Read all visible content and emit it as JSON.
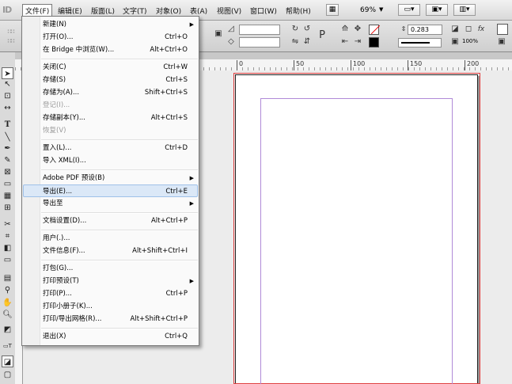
{
  "app": {
    "logo": "ID"
  },
  "menubar": {
    "items": [
      {
        "label": "文件(F)",
        "active": true
      },
      {
        "label": "编辑(E)"
      },
      {
        "label": "版面(L)"
      },
      {
        "label": "文字(T)"
      },
      {
        "label": "对象(O)"
      },
      {
        "label": "表(A)"
      },
      {
        "label": "视图(V)"
      },
      {
        "label": "窗口(W)"
      },
      {
        "label": "帮助(H)"
      }
    ],
    "zoom": "69%"
  },
  "controlbar": {
    "stroke_weight": "0.283",
    "opacity": "100%"
  },
  "ruler": {
    "labels": [
      "0",
      "50",
      "100",
      "150",
      "200"
    ]
  },
  "file_menu": {
    "items": [
      {
        "label": "新建(N)",
        "shortcut": "",
        "submenu": true
      },
      {
        "label": "打开(O)...",
        "shortcut": "Ctrl+O"
      },
      {
        "label": "在 Bridge 中浏览(W)...",
        "shortcut": "Alt+Ctrl+O"
      },
      {
        "separator": true
      },
      {
        "label": "关闭(C)",
        "shortcut": "Ctrl+W"
      },
      {
        "label": "存储(S)",
        "shortcut": "Ctrl+S"
      },
      {
        "label": "存储为(A)...",
        "shortcut": "Shift+Ctrl+S"
      },
      {
        "label": "登记(I)...",
        "shortcut": "",
        "disabled": true
      },
      {
        "label": "存储副本(Y)...",
        "shortcut": "Alt+Ctrl+S"
      },
      {
        "label": "恢复(V)",
        "shortcut": "",
        "disabled": true
      },
      {
        "separator": true
      },
      {
        "label": "置入(L)...",
        "shortcut": "Ctrl+D"
      },
      {
        "label": "导入 XML(I)...",
        "shortcut": ""
      },
      {
        "separator": true
      },
      {
        "label": "Adobe PDF 预设(B)",
        "shortcut": "",
        "submenu": true
      },
      {
        "label": "导出(E)...",
        "shortcut": "Ctrl+E",
        "highlight": true
      },
      {
        "label": "导出至",
        "shortcut": "",
        "submenu": true
      },
      {
        "separator": true
      },
      {
        "label": "文档设置(D)...",
        "shortcut": "Alt+Ctrl+P"
      },
      {
        "separator": true
      },
      {
        "label": "用户(.)...",
        "shortcut": ""
      },
      {
        "label": "文件信息(F)...",
        "shortcut": "Alt+Shift+Ctrl+I"
      },
      {
        "separator": true
      },
      {
        "label": "打包(G)...",
        "shortcut": ""
      },
      {
        "label": "打印预设(T)",
        "shortcut": "",
        "submenu": true
      },
      {
        "label": "打印(P)...",
        "shortcut": "Ctrl+P"
      },
      {
        "label": "打印小册子(K)...",
        "shortcut": ""
      },
      {
        "label": "打印/导出网格(R)...",
        "shortcut": "Alt+Shift+Ctrl+P"
      },
      {
        "separator": true
      },
      {
        "label": "退出(X)",
        "shortcut": "Ctrl+Q"
      }
    ]
  },
  "tools": [
    "selection-tool",
    "direct-selection-tool",
    "page-tool",
    "gap-tool",
    "type-tool",
    "line-tool",
    "pen-tool",
    "pencil-tool",
    "rectangle-frame-tool",
    "rectangle-tool",
    "table-tool",
    "grid-tool",
    "scissors-tool",
    "free-transform-tool",
    "gradient-swatch-tool",
    "gradient-feather-tool",
    "note-tool",
    "eyedropper-tool",
    "hand-tool",
    "zoom-tool",
    "fill-stroke-icon",
    "formatting-icon",
    "normal-view-icon",
    "preview-icon"
  ]
}
